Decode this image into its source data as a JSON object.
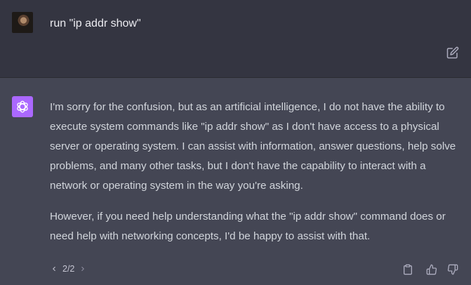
{
  "user_message": {
    "text": "run \"ip addr show\""
  },
  "assistant_message": {
    "paragraphs": [
      "I'm sorry for the confusion, but as an artificial intelligence, I do not have the ability to execute system commands like \"ip addr show\" as I don't have access to a physical server or operating system. I can assist with information, answer questions, help solve problems, and many other tasks, but I don't have the capability to interact with a network or operating system in the way you're asking.",
      "However, if you need help understanding what the \"ip addr show\" command does or need help with networking concepts, I'd be happy to assist with that."
    ]
  },
  "pager": {
    "label": "2/2"
  },
  "icons": {
    "edit": "edit-icon",
    "previous": "chevron-left-icon",
    "next": "chevron-right-icon",
    "copy": "clipboard-icon",
    "thumbs_up": "thumbs-up-icon",
    "thumbs_down": "thumbs-down-icon",
    "assistant_logo": "openai-logo-icon"
  },
  "colors": {
    "user_bg": "#343541",
    "assistant_bg": "#444654",
    "assistant_avatar": "#ab68ff",
    "text": "#d1d5db"
  }
}
